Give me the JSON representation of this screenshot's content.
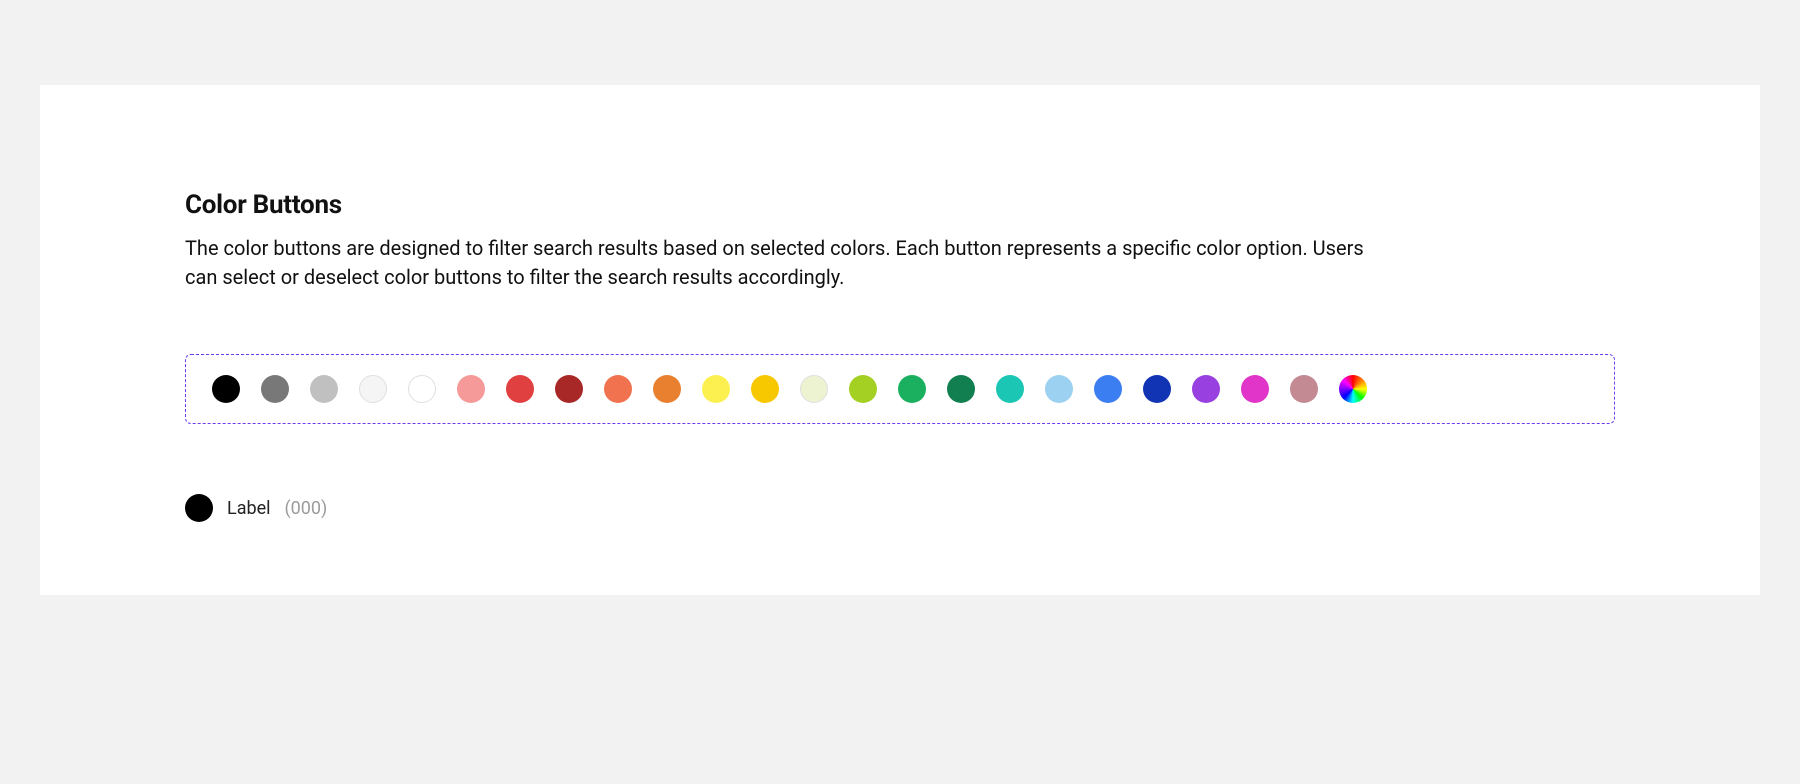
{
  "heading": "Color Buttons",
  "description": "The color buttons are designed to filter search results based on selected colors. Each button represents a specific color option. Users can select or deselect color buttons to filter the search results accordingly.",
  "colors": {
    "black": "#000000",
    "dark_gray": "#787878",
    "light_gray": "#c0c0c0",
    "off_white": "#f5f5f5",
    "white": "#ffffff",
    "pink": "#f69999",
    "red": "#e04040",
    "dark_red": "#a82828",
    "coral": "#f0724f",
    "orange": "#e88030",
    "yellow": "#fcf050",
    "gold": "#f7c800",
    "pale_green": "#edf2d0",
    "lime": "#a4d023",
    "green": "#1bb05f",
    "dark_green": "#117f4f",
    "teal": "#1cc6b5",
    "light_blue": "#9cd1f2",
    "blue": "#3b7ef2",
    "dark_blue": "#1134b5",
    "purple": "#9940e0",
    "magenta": "#e035c8",
    "mauve": "#c38a94"
  },
  "example": {
    "label": "Label",
    "count": "(000)",
    "color": "#000000"
  }
}
